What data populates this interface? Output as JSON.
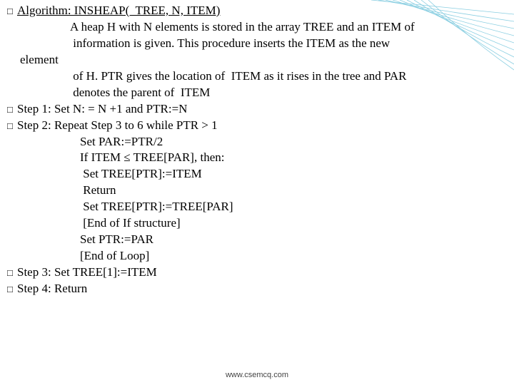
{
  "slide": {
    "l0": "Algorithm: INSHEAP(  TREE, N, ITEM)",
    "l1": "A heap H with N elements is stored in the array TREE and an ITEM of",
    "l2": " information is given. This procedure inserts the ITEM as the new",
    "l3": "element",
    "l4": " of H. PTR gives the location of  ITEM as it rises in the tree and PAR",
    "l5": " denotes the parent of  ITEM",
    "l6": "Step 1: Set N: = N +1 and PTR:=N",
    "l7": "Step 2: Repeat Step 3 to 6 while PTR > 1",
    "l8": "Set PAR:=PTR/2",
    "l9": "If ITEM ≤ TREE[PAR], then:",
    "l10": " Set TREE[PTR]:=ITEM",
    "l11": " Return",
    "l12": " Set TREE[PTR]:=TREE[PAR]",
    "l13": " [End of If structure]",
    "l14": "Set PTR:=PAR",
    "l15": "[End of Loop]",
    "l16": "Step 3: Set TREE[1]:=ITEM",
    "l17": "Step 4: Return",
    "footer": "www.csemcq.com"
  }
}
